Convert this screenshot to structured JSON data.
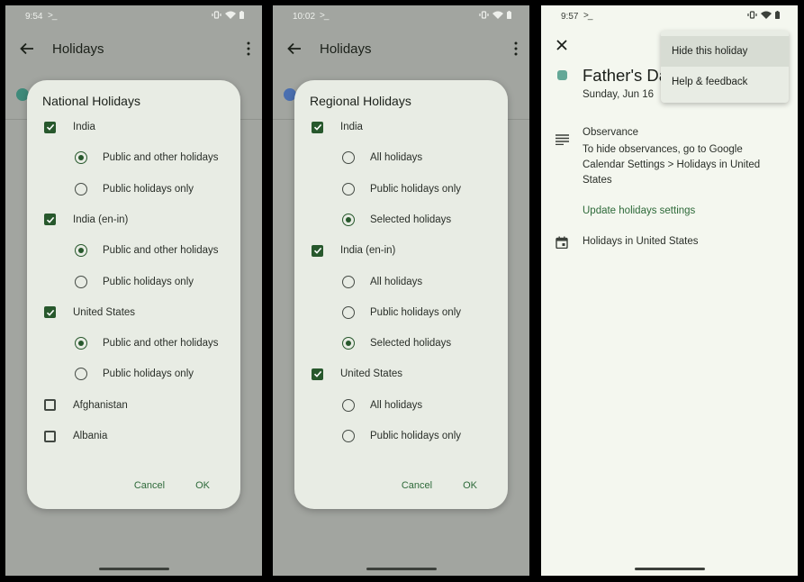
{
  "screens": [
    {
      "status": {
        "time": "9:54"
      },
      "appbar": {
        "title": "Holidays"
      },
      "dialog": {
        "title": "National Holidays",
        "items": [
          {
            "kind": "checkbox",
            "label": "India",
            "checked": true
          },
          {
            "kind": "radio",
            "label": "Public and other holidays",
            "selected": true
          },
          {
            "kind": "radio",
            "label": "Public holidays only",
            "selected": false
          },
          {
            "kind": "checkbox",
            "label": "India (en-in)",
            "checked": true
          },
          {
            "kind": "radio",
            "label": "Public and other holidays",
            "selected": true
          },
          {
            "kind": "radio",
            "label": "Public holidays only",
            "selected": false
          },
          {
            "kind": "checkbox",
            "label": "United States",
            "checked": true
          },
          {
            "kind": "radio",
            "label": "Public and other holidays",
            "selected": true
          },
          {
            "kind": "radio",
            "label": "Public holidays only",
            "selected": false
          },
          {
            "kind": "checkbox",
            "label": "Afghanistan",
            "checked": false
          },
          {
            "kind": "checkbox",
            "label": "Albania",
            "checked": false
          }
        ],
        "cancel_label": "Cancel",
        "ok_label": "OK"
      }
    },
    {
      "status": {
        "time": "10:02"
      },
      "appbar": {
        "title": "Holidays"
      },
      "dialog": {
        "title": "Regional Holidays",
        "items": [
          {
            "kind": "checkbox",
            "label": "India",
            "checked": true
          },
          {
            "kind": "radio",
            "label": "All holidays",
            "selected": false
          },
          {
            "kind": "radio",
            "label": "Public holidays only",
            "selected": false
          },
          {
            "kind": "radio",
            "label": "Selected holidays",
            "selected": true
          },
          {
            "kind": "checkbox",
            "label": "India (en-in)",
            "checked": true
          },
          {
            "kind": "radio",
            "label": "All holidays",
            "selected": false
          },
          {
            "kind": "radio",
            "label": "Public holidays only",
            "selected": false
          },
          {
            "kind": "radio",
            "label": "Selected holidays",
            "selected": true
          },
          {
            "kind": "checkbox",
            "label": "United States",
            "checked": true
          },
          {
            "kind": "radio",
            "label": "All holidays",
            "selected": false
          },
          {
            "kind": "radio",
            "label": "Public holidays only",
            "selected": false
          }
        ],
        "cancel_label": "Cancel",
        "ok_label": "OK"
      }
    },
    {
      "status": {
        "time": "9:57"
      },
      "event": {
        "title": "Father's Day",
        "date": "Sunday, Jun 16",
        "observance_title": "Observance",
        "observance_text": "To hide observances, go to Google Calendar Settings > Holidays in United States",
        "update_link": "Update holidays settings",
        "calendar": "Holidays in United States"
      },
      "menu": {
        "items": [
          {
            "label": "Hide this holiday"
          },
          {
            "label": "Help & feedback"
          }
        ]
      }
    }
  ],
  "colors": {
    "accent": "#27582c",
    "link": "#2e6a3a",
    "event_color": "#64a897",
    "scrim_bg": "#a2a5a0",
    "surface": "#f4f7ef",
    "dialog_bg": "#e8ece4"
  }
}
